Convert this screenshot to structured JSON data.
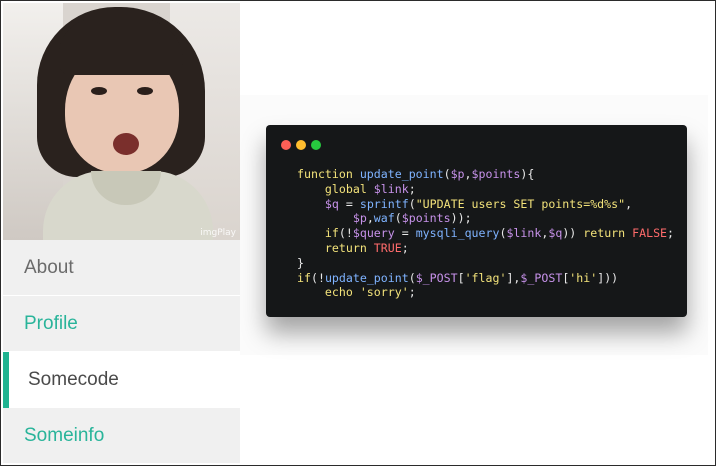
{
  "sidebar": {
    "image_alt": "girl-photo",
    "watermark": "imgPlay",
    "items": [
      {
        "label": "About"
      },
      {
        "label": "Profile"
      },
      {
        "label": "Somecode"
      },
      {
        "label": "Someinfo"
      }
    ]
  },
  "code": {
    "window_dots": [
      "#ff5f56",
      "#ffbd2e",
      "#27c93f"
    ],
    "lines": [
      "function update_point($p,$points){",
      "    global $link;",
      "    $q = sprintf(\"UPDATE users SET points=%d%s\",",
      "        $p,waf($points));",
      "    if(!$query = mysqli_query($link,$q)) return FALSE;",
      "    return TRUE;",
      "}",
      "if(!update_point($_POST['flag'],$_POST['hi']))",
      "    echo 'sorry';"
    ]
  },
  "colors": {
    "accent": "#1fb390",
    "link": "#29b49a",
    "menu_bg": "#f0f0f0",
    "code_bg": "#151718"
  }
}
